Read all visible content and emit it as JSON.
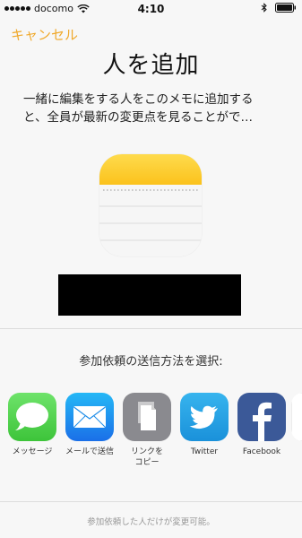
{
  "status_bar": {
    "carrier": "docomo",
    "time": "4:10"
  },
  "nav": {
    "cancel_label": "キャンセル"
  },
  "title": "人を追加",
  "description": {
    "line1": "一緒に編集をする人をこのメモに追加する",
    "line2": "と、全員が最新の変更点を見ることがで…"
  },
  "share_prompt": "参加依頼の送信方法を選択:",
  "share_options": [
    {
      "label": "メッセージ",
      "icon": "messages-icon",
      "color": "#4cd964"
    },
    {
      "label": "メールで送信",
      "icon": "mail-icon",
      "color": "#1e87f0"
    },
    {
      "label": "リンクを\nコピー",
      "icon": "copy-link-icon",
      "color": "#8e8e93"
    },
    {
      "label": "Twitter",
      "icon": "twitter-icon",
      "color": "#1da1f2"
    },
    {
      "label": "Facebook",
      "icon": "facebook-icon",
      "color": "#3b5998"
    }
  ],
  "footer_note": "参加依頼した人だけが変更可能。",
  "colors": {
    "accent": "#f0a92c",
    "notes_yellow": "#fdcb2f"
  }
}
